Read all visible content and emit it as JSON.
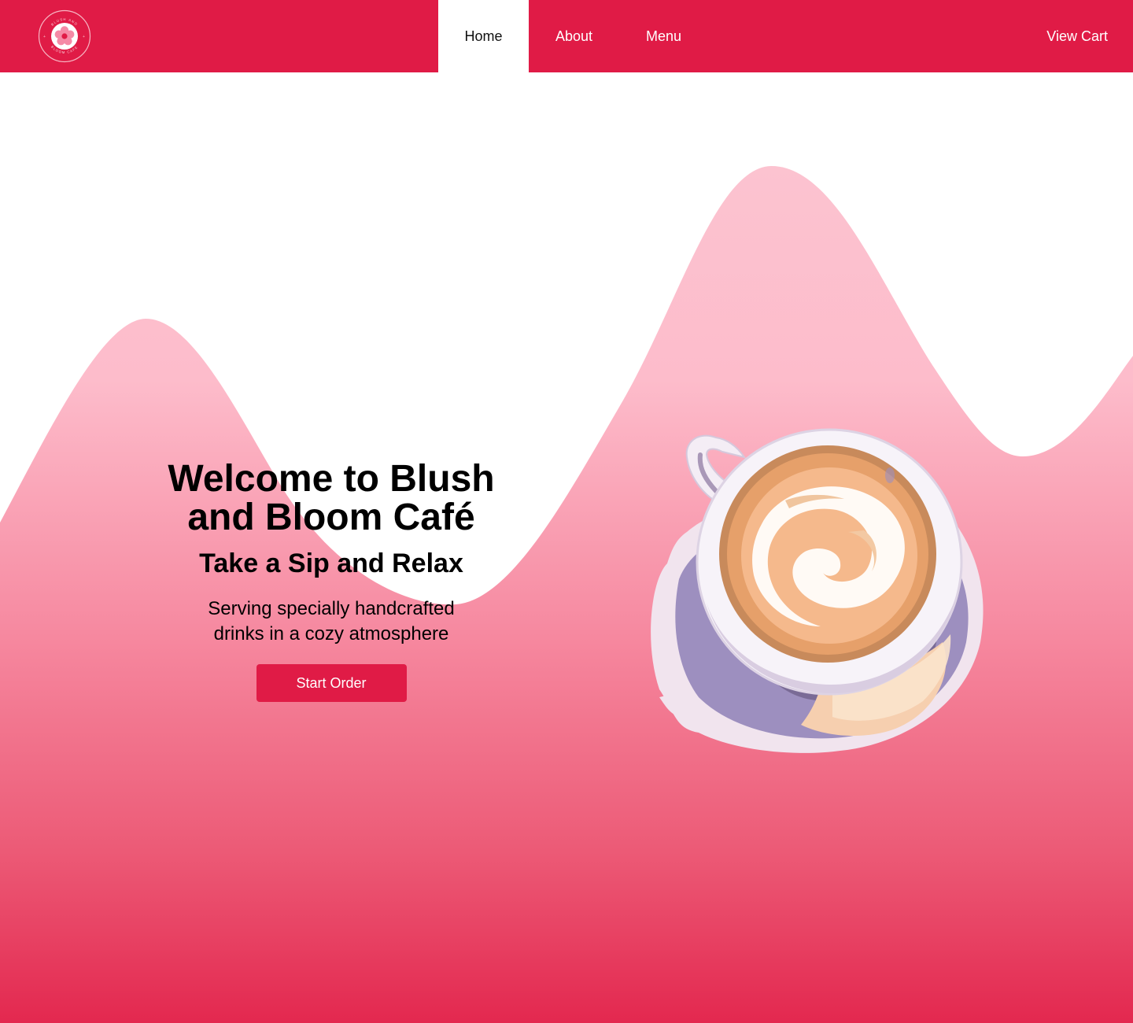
{
  "navbar": {
    "logo": {
      "icon": "flower-icon",
      "ring_text_top": "BLUSH AND",
      "ring_text_bottom": "BLOOM CAFE"
    },
    "links": [
      {
        "label": "Home",
        "active": true
      },
      {
        "label": "About",
        "active": false
      },
      {
        "label": "Menu",
        "active": false
      }
    ],
    "cart_label": "View Cart"
  },
  "hero": {
    "title": "Welcome to Blush and Bloom Café",
    "subtitle": "Take a Sip and Relax",
    "description": "Serving specially handcrafted drinks in a cozy atmosphere",
    "cta_label": "Start Order",
    "image": "latte-cup-illustration"
  },
  "colors": {
    "brand": "#e01b46",
    "wave_top": "#fcc3d0",
    "wave_bottom": "#e3284f",
    "nav_text": "#ffffff"
  }
}
